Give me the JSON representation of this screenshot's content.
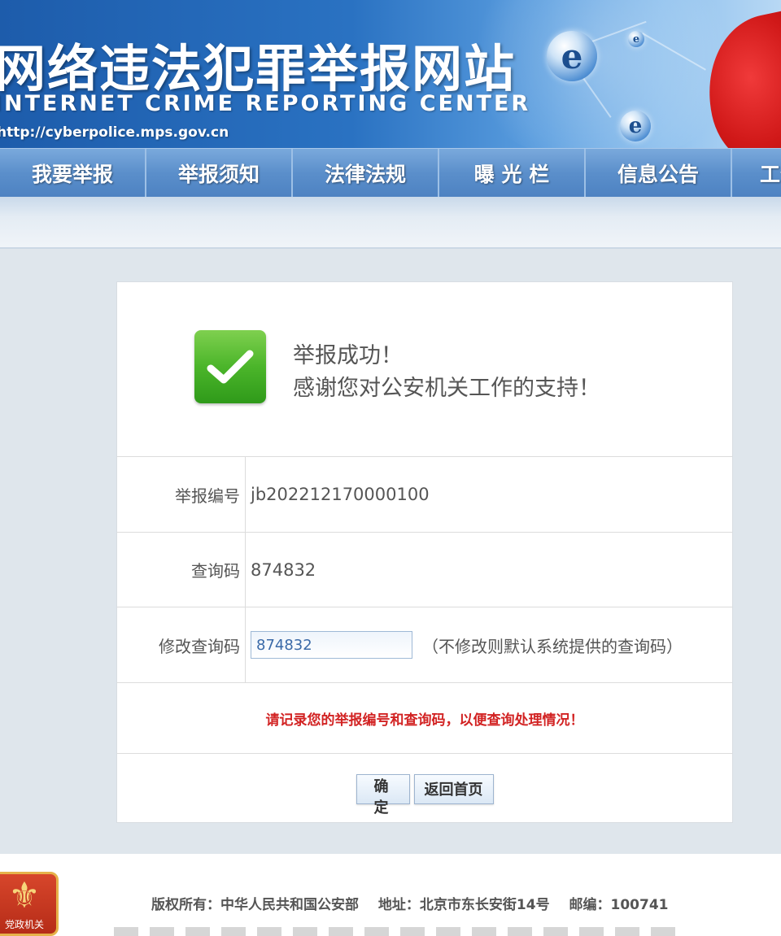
{
  "banner": {
    "title_cn": "网络违法犯罪举报网站",
    "title_en": "INTERNET CRIME REPORTING CENTER",
    "url": "http://cyberpolice.mps.gov.cn"
  },
  "nav": {
    "items": [
      {
        "label": "我要举报"
      },
      {
        "label": "举报须知"
      },
      {
        "label": "法律法规"
      },
      {
        "label": "曝 光 栏"
      },
      {
        "label": "信息公告"
      },
      {
        "label": "工作"
      }
    ]
  },
  "result": {
    "title": "举报成功！",
    "subtitle": "感谢您对公安机关工作的支持！",
    "report_no_label": "举报编号",
    "report_no": "jb202212170000100",
    "query_code_label": "查询码",
    "query_code": "874832",
    "edit_query_label": "修改查询码",
    "edit_query_value": "874832",
    "edit_query_hint": "（不修改则默认系统提供的查询码）",
    "notice": "请记录您的举报编号和查询码，以便查询处理情况！",
    "confirm_label": "确 定",
    "home_label": "返回首页"
  },
  "footer": {
    "copyright": "版权所有：中华人民共和国公安部",
    "address": "地址：北京市东长安街14号",
    "postcode": "邮编：100741",
    "emblem_caption": "党政机关"
  },
  "colors": {
    "banner_blue": "#2a72c2",
    "nav_blue": "#5b8fcb",
    "success_green": "#4bb52a",
    "notice_red": "#d22323"
  }
}
